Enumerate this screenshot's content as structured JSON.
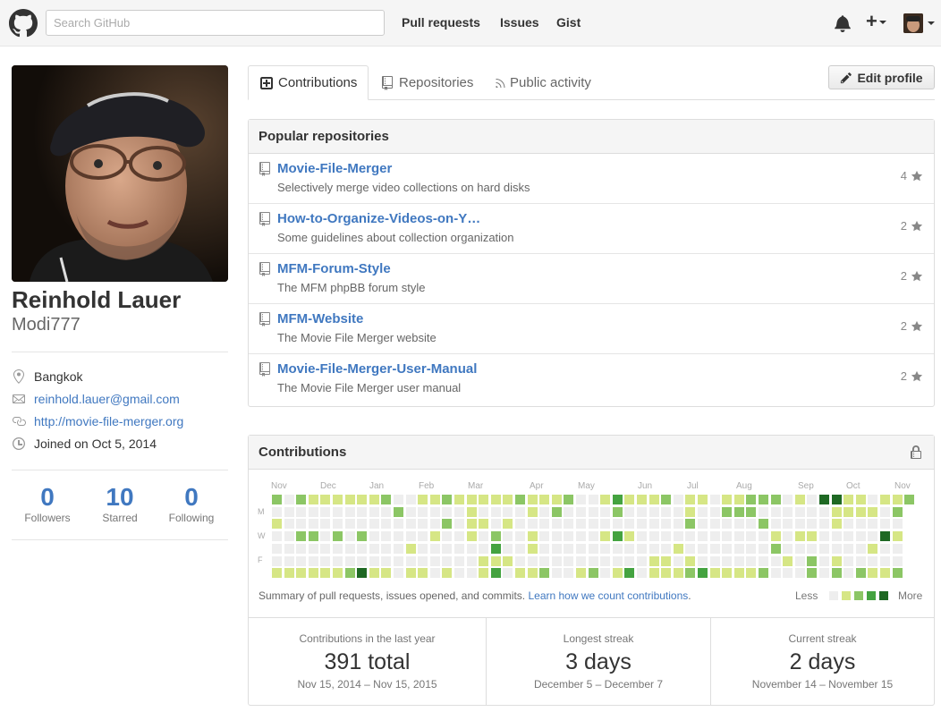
{
  "header": {
    "search_placeholder": "Search GitHub",
    "nav": [
      "Pull requests",
      "Issues",
      "Gist"
    ]
  },
  "profile": {
    "fullname": "Reinhold Lauer",
    "username": "Modi777",
    "location": "Bangkok",
    "email": "reinhold.lauer@gmail.com",
    "website": "http://movie-file-merger.org",
    "joined": "Joined on Oct 5, 2014",
    "stats": [
      {
        "value": "0",
        "label": "Followers"
      },
      {
        "value": "10",
        "label": "Starred"
      },
      {
        "value": "0",
        "label": "Following"
      }
    ]
  },
  "tabs": {
    "contributions": "Contributions",
    "repositories": "Repositories",
    "public_activity": "Public activity",
    "edit_profile": "Edit profile"
  },
  "popular": {
    "title": "Popular repositories",
    "repos": [
      {
        "name": "Movie-File-Merger",
        "desc": "Selectively merge video collections on hard disks",
        "stars": "4"
      },
      {
        "name": "How-to-Organize-Videos-on-Y…",
        "desc": "Some guidelines about collection organization",
        "stars": "2"
      },
      {
        "name": "MFM-Forum-Style",
        "desc": "The MFM phpBB forum style",
        "stars": "2"
      },
      {
        "name": "MFM-Website",
        "desc": "The Movie File Merger website",
        "stars": "2"
      },
      {
        "name": "Movie-File-Merger-User-Manual",
        "desc": "The Movie File Merger user manual",
        "stars": "2"
      }
    ]
  },
  "contributions": {
    "title": "Contributions",
    "months": [
      "Nov",
      "Dec",
      "Jan",
      "Feb",
      "Mar",
      "Apr",
      "May",
      "Jun",
      "Jul",
      "Aug",
      "Sep",
      "Oct",
      "Nov"
    ],
    "day_labels": [
      "M",
      "W",
      "F"
    ],
    "summary_text": "Summary of pull requests, issues opened, and commits. ",
    "summary_link": "Learn how we count contributions",
    "summary_end": ".",
    "legend_less": "Less",
    "legend_more": "More",
    "colors": [
      "#eeeeee",
      "#d6e685",
      "#8cc665",
      "#44a340",
      "#1e6823"
    ],
    "streaks": [
      {
        "title": "Contributions in the last year",
        "value": "391 total",
        "dates": "Nov 15, 2014 – Nov 15, 2015"
      },
      {
        "title": "Longest streak",
        "value": "3 days",
        "dates": "December 5 – December 7"
      },
      {
        "title": "Current streak",
        "value": "2 days",
        "dates": "November 14 – November 15"
      }
    ]
  }
}
